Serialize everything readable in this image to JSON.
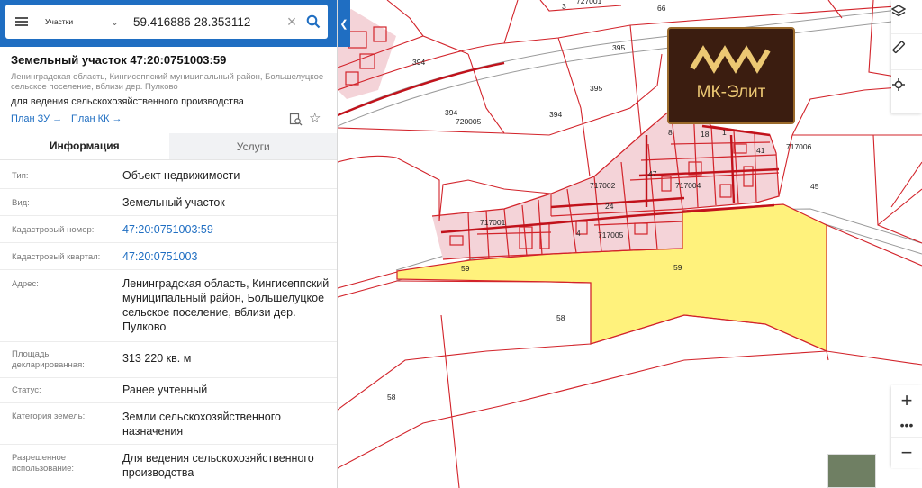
{
  "search": {
    "type_label": "Участки",
    "value": "59.416886 28.353112"
  },
  "parcel": {
    "title": "Земельный участок 47:20:0751003:59",
    "address": "Ленинградская область, Кингисеппский муниципальный район, Большелуцкое сельское поселение, вблизи дер. Пулково",
    "purpose": "для ведения сельскохозяйственного производства",
    "plan_zu": "План ЗУ →",
    "plan_kk": "План КК →"
  },
  "tabs": [
    "Информация",
    "Услуги"
  ],
  "info_rows": [
    {
      "key": "Тип:",
      "value": "Объект недвижимости"
    },
    {
      "key": "Вид:",
      "value": "Земельный участок"
    },
    {
      "key": "Кадастровый номер:",
      "value": "47:20:0751003:59"
    },
    {
      "key": "Кадастровый квартал:",
      "value": "47:20:0751003"
    },
    {
      "key": "Адрес:",
      "value": "Ленинградская область, Кингисеппский муниципальный район, Большелуцкое сельское поселение, вблизи дер. Пулково"
    },
    {
      "key": "Площадь декларированная:",
      "value": "313 220 кв. м"
    },
    {
      "key": "Статус:",
      "value": "Ранее учтенный"
    },
    {
      "key": "Категория земель:",
      "value": "Земли сельскохозяйственного назначения"
    },
    {
      "key": "Разрешенное использование:",
      "value": "Для ведения сельскохозяйственного производства"
    }
  ],
  "map_labels": {
    "p394a": "394",
    "p394b": "394",
    "p394c": "394",
    "p395a": "395",
    "p395b": "395",
    "q720005": "720005",
    "q717006": "717006",
    "q717002": "717002",
    "q717004": "717004",
    "q717001": "717001",
    "q717005": "717005",
    "p45": "45",
    "p59a": "59",
    "p59b": "59",
    "p58a": "58",
    "p58b": "58",
    "p66": "66",
    "p3": "3",
    "p47": "47",
    "p4": "4",
    "p24": "24",
    "p41": "41",
    "p18": "18",
    "p1": "1",
    "p8": "8",
    "p7001": "727001"
  },
  "logo": {
    "text": "МК-Элит"
  },
  "colors": {
    "header_blue": "#1f6ec2",
    "parcel_red": "#d2232a",
    "highlight_yellow": "#fff27c",
    "village_fill": "#f4d3d8",
    "logo_bg": "#3b1d10",
    "logo_gold": "#ecc873"
  },
  "icons": {
    "menu": "hamburger-icon",
    "search": "search-icon",
    "clear": "close-icon",
    "layers": "layers-icon",
    "ruler": "ruler-icon",
    "locate": "crosshair-icon",
    "zoom_in": "plus-icon",
    "zoom_out": "minus-icon",
    "more": "more-icon",
    "favorite": "star-icon",
    "document": "document-search-icon"
  }
}
